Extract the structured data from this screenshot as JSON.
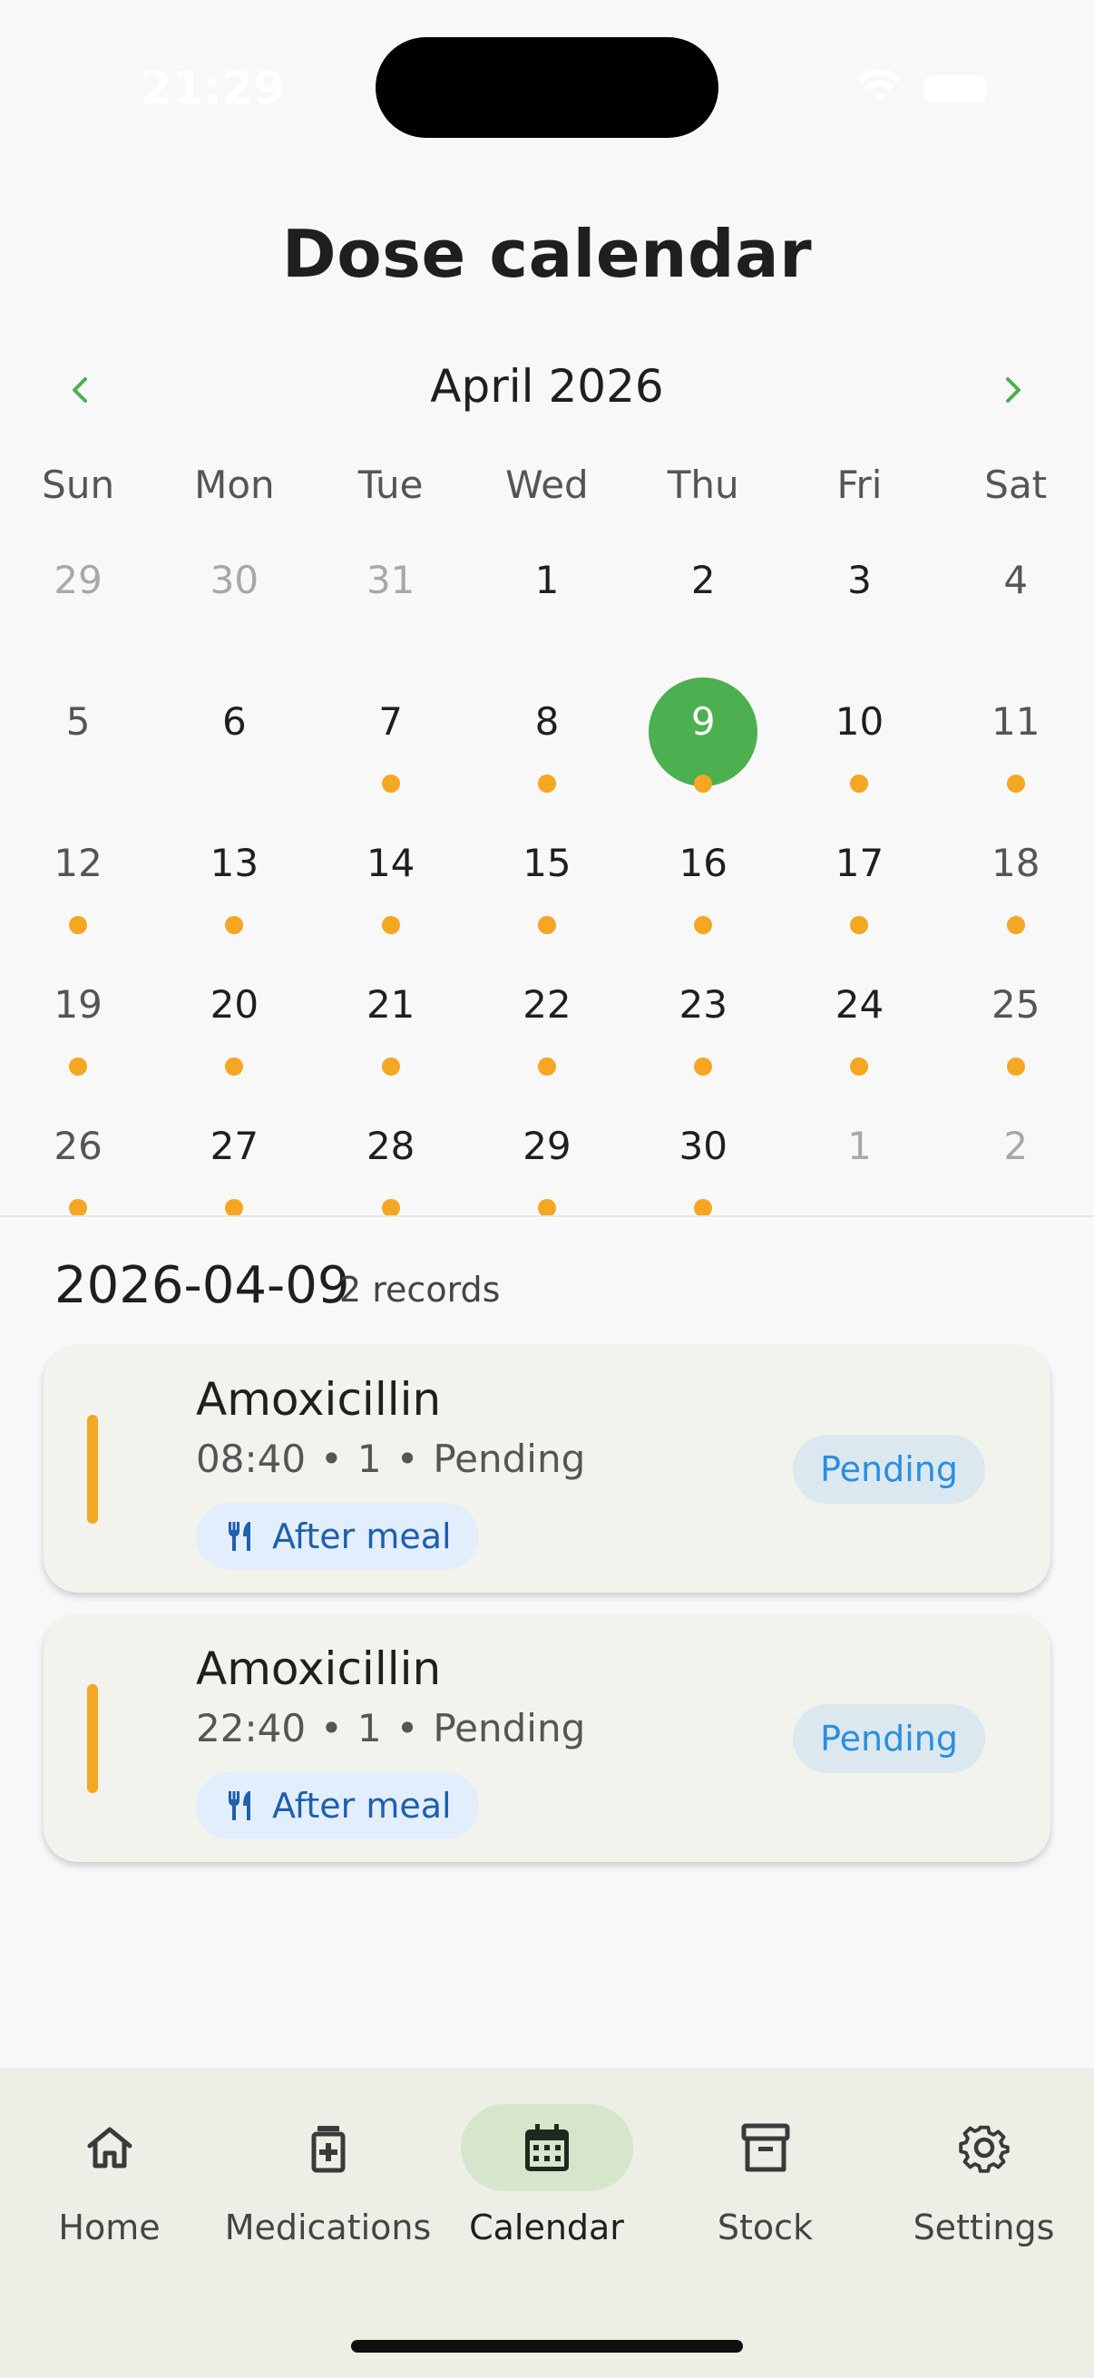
{
  "status_bar": {
    "time": "21:29"
  },
  "page": {
    "title": "Dose calendar"
  },
  "calendar": {
    "month_label": "April 2026",
    "weekdays": [
      "Sun",
      "Mon",
      "Tue",
      "Wed",
      "Thu",
      "Fri",
      "Sat"
    ],
    "weeks": [
      [
        {
          "day": "29",
          "outside": true,
          "dot": false
        },
        {
          "day": "30",
          "outside": true,
          "dot": false
        },
        {
          "day": "31",
          "outside": true,
          "dot": false
        },
        {
          "day": "1",
          "outside": false,
          "dot": false
        },
        {
          "day": "2",
          "outside": false,
          "dot": false
        },
        {
          "day": "3",
          "outside": false,
          "dot": false
        },
        {
          "day": "4",
          "outside": false,
          "dot": false
        }
      ],
      [
        {
          "day": "5",
          "outside": false,
          "dot": false
        },
        {
          "day": "6",
          "outside": false,
          "dot": false
        },
        {
          "day": "7",
          "outside": false,
          "dot": true
        },
        {
          "day": "8",
          "outside": false,
          "dot": true
        },
        {
          "day": "9",
          "outside": false,
          "dot": true,
          "selected": true
        },
        {
          "day": "10",
          "outside": false,
          "dot": true
        },
        {
          "day": "11",
          "outside": false,
          "dot": true
        }
      ],
      [
        {
          "day": "12",
          "outside": false,
          "dot": true
        },
        {
          "day": "13",
          "outside": false,
          "dot": true
        },
        {
          "day": "14",
          "outside": false,
          "dot": true
        },
        {
          "day": "15",
          "outside": false,
          "dot": true
        },
        {
          "day": "16",
          "outside": false,
          "dot": true
        },
        {
          "day": "17",
          "outside": false,
          "dot": true
        },
        {
          "day": "18",
          "outside": false,
          "dot": true
        }
      ],
      [
        {
          "day": "19",
          "outside": false,
          "dot": true
        },
        {
          "day": "20",
          "outside": false,
          "dot": true
        },
        {
          "day": "21",
          "outside": false,
          "dot": true
        },
        {
          "day": "22",
          "outside": false,
          "dot": true
        },
        {
          "day": "23",
          "outside": false,
          "dot": true
        },
        {
          "day": "24",
          "outside": false,
          "dot": true
        },
        {
          "day": "25",
          "outside": false,
          "dot": true
        }
      ],
      [
        {
          "day": "26",
          "outside": false,
          "dot": true
        },
        {
          "day": "27",
          "outside": false,
          "dot": true
        },
        {
          "day": "28",
          "outside": false,
          "dot": true
        },
        {
          "day": "29",
          "outside": false,
          "dot": true
        },
        {
          "day": "30",
          "outside": false,
          "dot": true
        },
        {
          "day": "1",
          "outside": true,
          "dot": false
        },
        {
          "day": "2",
          "outside": true,
          "dot": false
        }
      ]
    ]
  },
  "records": {
    "date": "2026-04-09",
    "count_label": "2 records",
    "items": [
      {
        "name": "Amoxicillin",
        "time": "08:40",
        "dose": "1",
        "status_text": "Pending",
        "meal": "After meal",
        "status_badge": "Pending"
      },
      {
        "name": "Amoxicillin",
        "time": "22:40",
        "dose": "1",
        "status_text": "Pending",
        "meal": "After meal",
        "status_badge": "Pending"
      }
    ]
  },
  "bottom_nav": {
    "items": [
      {
        "label": "Home",
        "icon": "home-icon"
      },
      {
        "label": "Medications",
        "icon": "medication-icon"
      },
      {
        "label": "Calendar",
        "icon": "calendar-icon",
        "active": true
      },
      {
        "label": "Stock",
        "icon": "archive-icon"
      },
      {
        "label": "Settings",
        "icon": "gear-icon"
      }
    ]
  },
  "colors": {
    "accent_green": "#4caf50",
    "dot_orange": "#f5a623",
    "pending_blue": "#2a8fe0",
    "meal_tag_text": "#1e5fae"
  }
}
